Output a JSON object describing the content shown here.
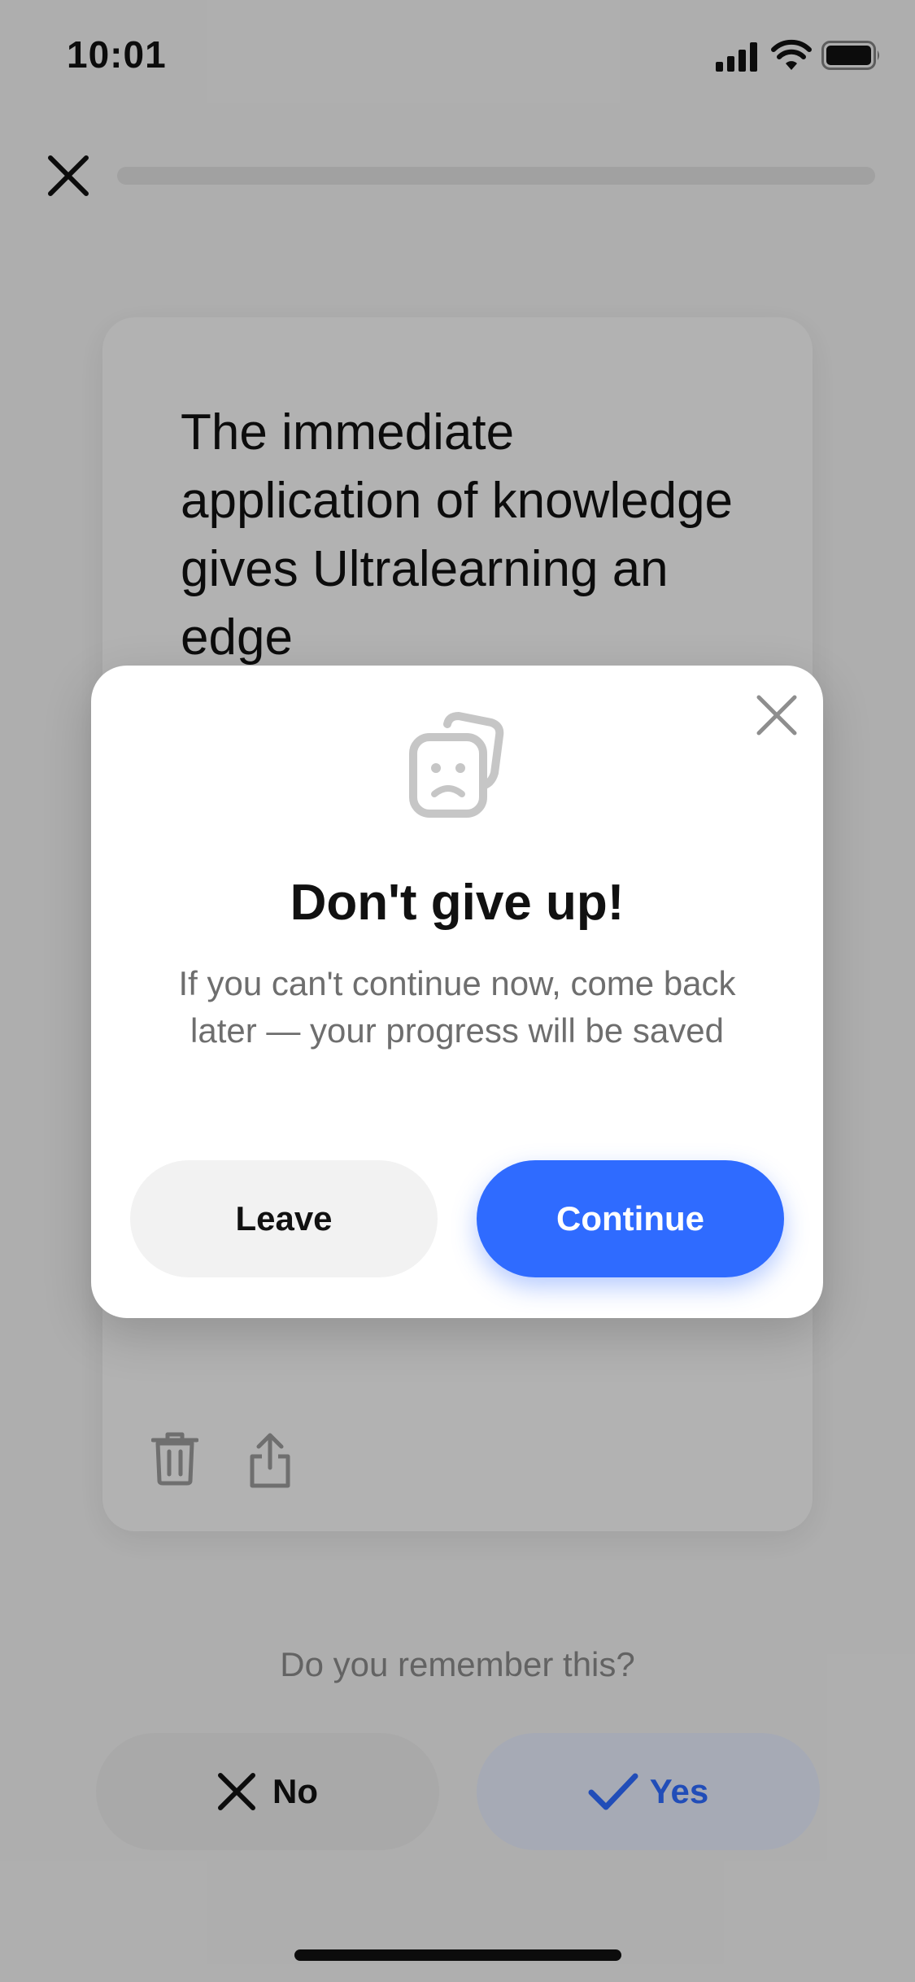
{
  "status_bar": {
    "time": "10:01"
  },
  "lesson": {
    "progress_percent": 0,
    "card_text": "The immediate application of knowledge gives Ultralearning an edge"
  },
  "prompt": {
    "question": "Do you remember this?",
    "no_label": "No",
    "yes_label": "Yes"
  },
  "modal": {
    "title": "Don't give up!",
    "body": "If you can't continue now, come back later — your progress will be saved",
    "leave_label": "Leave",
    "continue_label": "Continue"
  },
  "colors": {
    "accent": "#2f6bff",
    "accent_light": "#e6ecfb"
  },
  "icons": [
    "close-icon",
    "trash-icon",
    "share-icon",
    "sad-cards-icon",
    "check-icon",
    "signal-icon",
    "wifi-icon",
    "battery-icon"
  ]
}
